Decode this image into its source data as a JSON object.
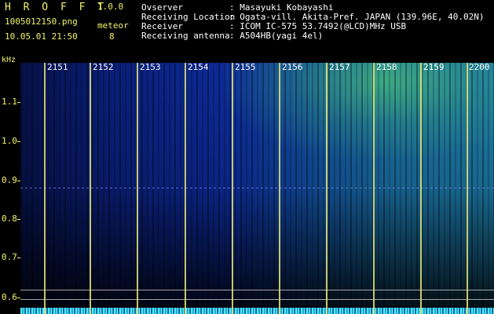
{
  "header": {
    "app_name": "H R O F F T",
    "version": "1.0.0",
    "filename": "1005012150.png",
    "datetime": "10.05.01 21:50",
    "meteor_label": "meteor",
    "meteor_count": "8"
  },
  "info": [
    {
      "label": "Ovserver",
      "value": ": Masayuki Kobayashi"
    },
    {
      "label": "Receiving Location",
      "value": ": Ogata-vill. Akita-Pref. JAPAN (139.96E, 40.02N)"
    },
    {
      "label": "Receiver",
      "value": ": ICOM IC-575 53.7492(@LCD)MHz USB"
    },
    {
      "label": "Receiving antenna",
      "value": ": A504HB(yagi 4el)"
    }
  ],
  "chart_data": {
    "type": "heatmap",
    "ylabel": "kHz",
    "y_ticks": [
      "1.1",
      "1.0",
      "0.9",
      "0.8",
      "0.7",
      "0.6"
    ],
    "x_ticks": [
      "2151",
      "2152",
      "2153",
      "2154",
      "2155",
      "2156",
      "2157",
      "2158",
      "2159",
      "2200"
    ],
    "accent": "#f2f26a"
  }
}
